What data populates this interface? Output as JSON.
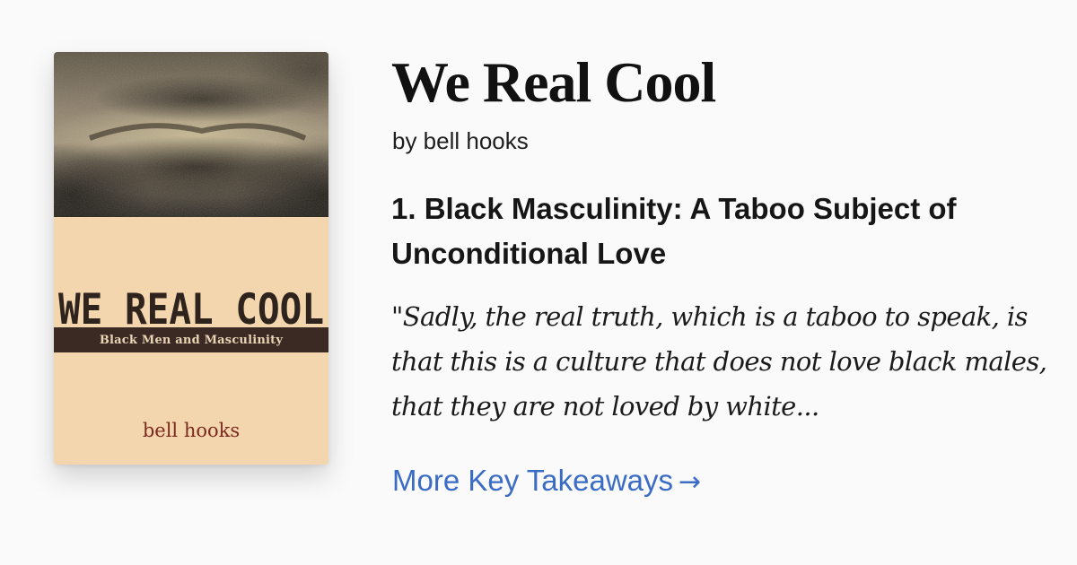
{
  "cover": {
    "title_art": "WE REAL COOL",
    "subtitle": "Black Men and Masculinity",
    "author": "bell hooks",
    "colors": {
      "background": "#f3d6ae",
      "band": "#3b2a23",
      "author_text": "#7a2a1f"
    }
  },
  "book": {
    "title": "We Real Cool",
    "byline": "by bell hooks"
  },
  "takeaway": {
    "heading": "1. Black Masculinity: A Taboo Subject of Unconditional Love",
    "quote": "\"Sadly, the real truth, which is a taboo to speak, is that this is a culture that does not love black males, that they are not loved by white..."
  },
  "link": {
    "label": "More Key Takeaways",
    "icon": "arrow-right-icon",
    "arrow": "→",
    "color": "#3a6cc5"
  }
}
